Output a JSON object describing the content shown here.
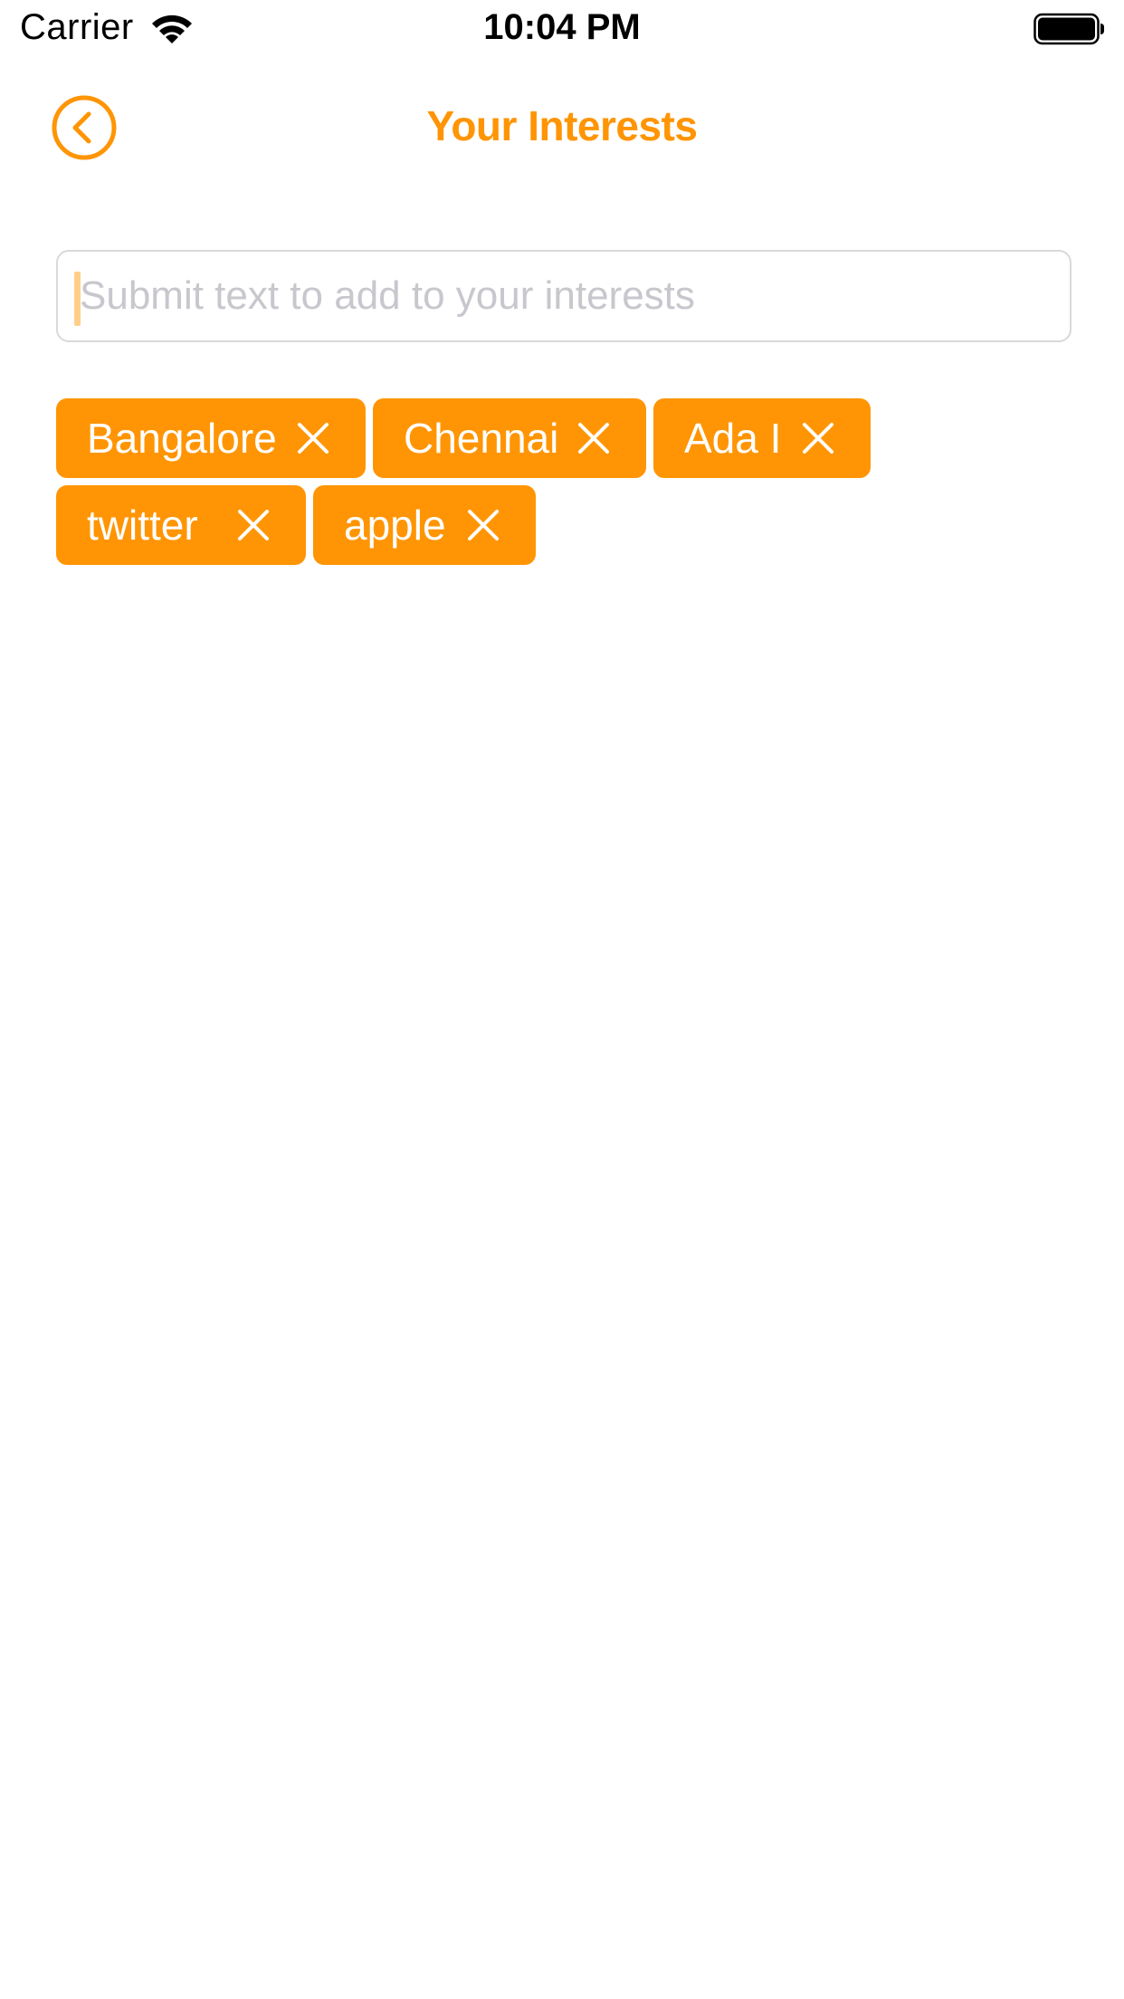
{
  "status_bar": {
    "carrier": "Carrier",
    "time": "10:04 PM",
    "wifi_icon": "wifi-icon",
    "battery_icon": "battery-full-icon"
  },
  "nav": {
    "back_icon": "chevron-left-circle-icon",
    "title": "Your Interests"
  },
  "input": {
    "placeholder": "Submit text to add to your interests",
    "value": ""
  },
  "tags": [
    {
      "label": "Bangalore",
      "remove_icon": "close-icon"
    },
    {
      "label": "Chennai",
      "remove_icon": "close-icon"
    },
    {
      "label": "Ada I",
      "remove_icon": "close-icon"
    },
    {
      "label": "twitter",
      "remove_icon": "close-icon"
    },
    {
      "label": "apple",
      "remove_icon": "close-icon"
    }
  ],
  "colors": {
    "accent": "#FF9504",
    "tag_text": "#FFFFFF",
    "placeholder": "#C7C7CD",
    "input_border": "#D9D9D9"
  }
}
